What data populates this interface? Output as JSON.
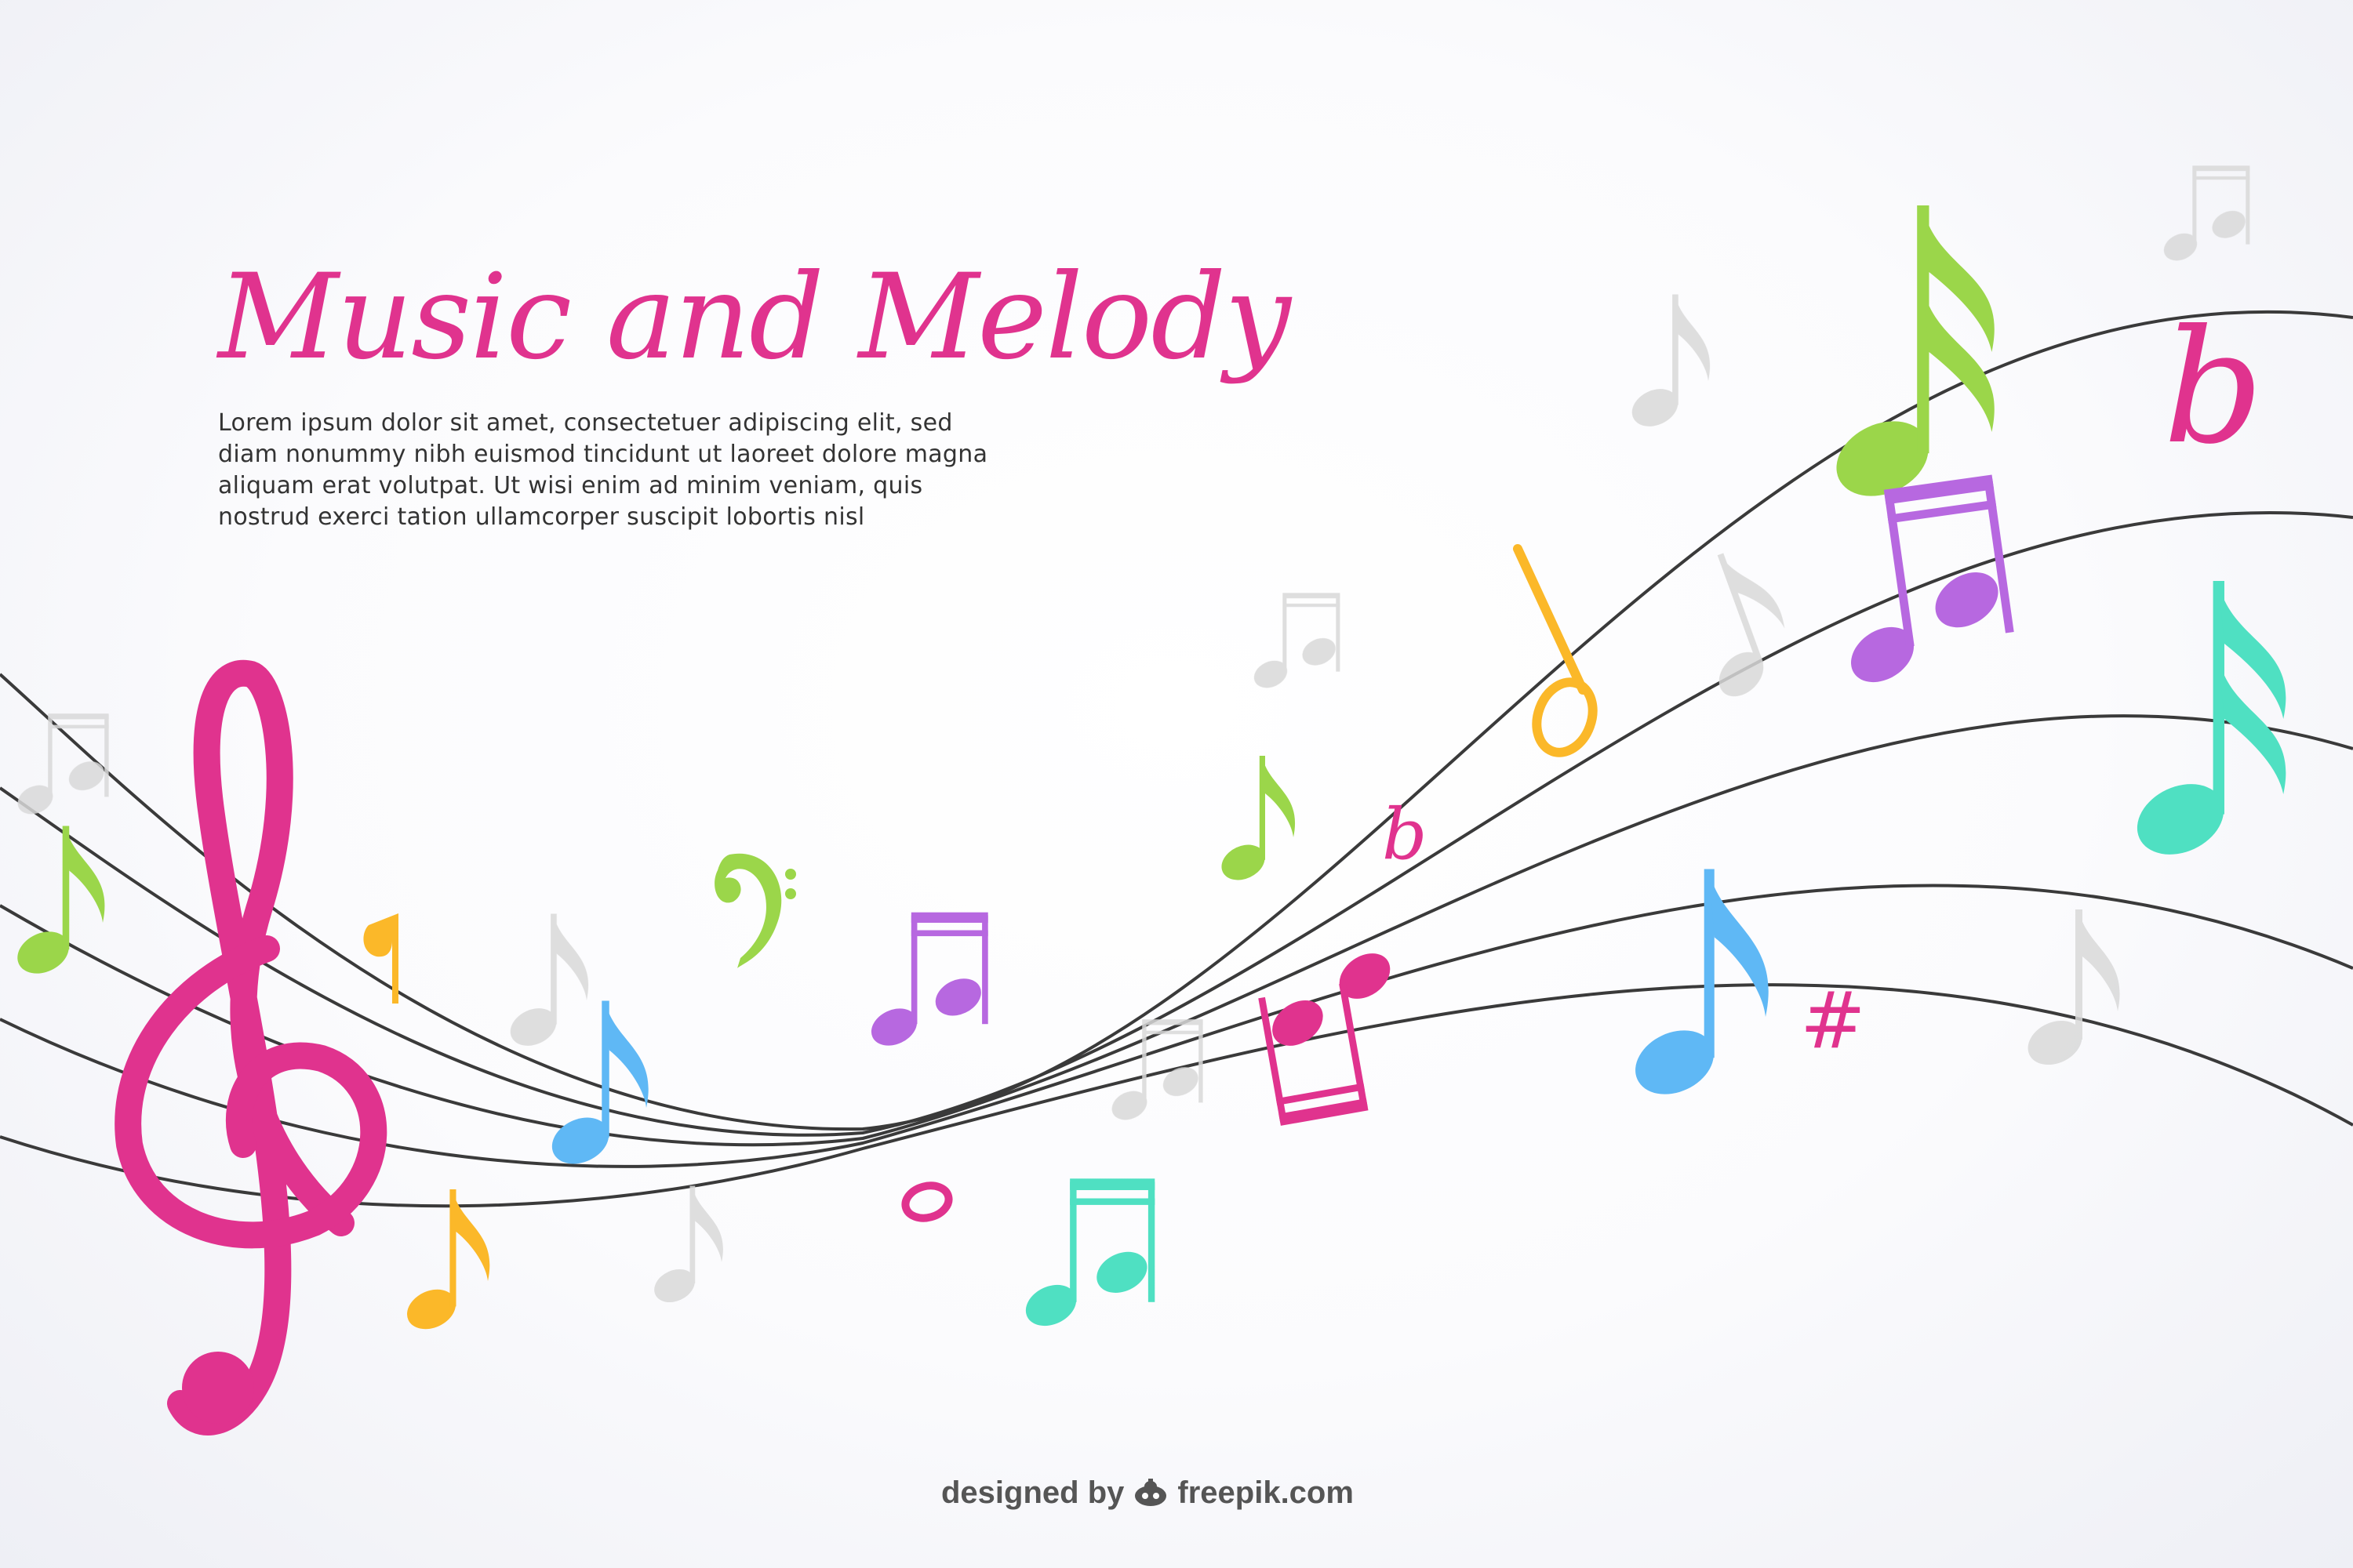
{
  "title": "Music and Melody",
  "body_lines": [
    "Lorem ipsum dolor sit amet, consectetuer adipiscing elit, sed",
    "diam nonummy nibh euismod tincidunt ut laoreet dolore magna",
    "aliquam erat volutpat. Ut wisi enim ad minim veniam, quis",
    "nostrud exerci tation ullamcorper suscipit lobortis nisl"
  ],
  "credit": {
    "prefix": "designed by",
    "brand": "freepik.com"
  },
  "symbols": {
    "sharp": "#",
    "flat": "b"
  },
  "colors": {
    "pink": "#e0338e",
    "green": "#9bd64a",
    "yellow": "#fbb829",
    "blue": "#5fb8f5",
    "purple": "#b768e0",
    "teal": "#4fe0c2",
    "staff": "#3a3a3a",
    "ghost": "#d9d9d9"
  },
  "icons": [
    "treble-clef-icon",
    "bass-clef-icon",
    "eighth-note-icon",
    "beamed-notes-icon",
    "whole-note-icon",
    "flat-icon",
    "sharp-icon",
    "freepik-logo-icon"
  ]
}
